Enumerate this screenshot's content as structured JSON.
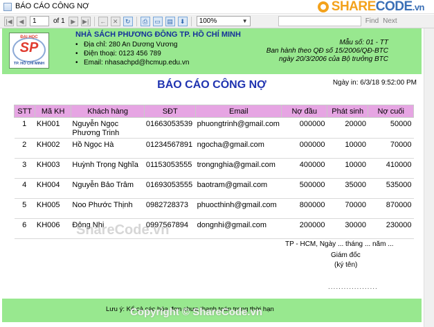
{
  "window": {
    "title": "BÁO CÁO CÔNG NỢ"
  },
  "brand": {
    "logo_part1": "SHARE",
    "logo_part2": "CODE",
    "logo_suffix": ".vn"
  },
  "toolbar": {
    "page_current": "1",
    "page_of": "of 1",
    "zoom": "100%",
    "find_label": "Find",
    "next_label": "Next"
  },
  "school_logo": {
    "top_text": "ĐẠI HỌC",
    "mark": "SP",
    "bottom_text": "TP. HỒ CHÍ MINH"
  },
  "store": {
    "name": "NHÀ SÁCH PHƯƠNG ĐÔNG TP. HỒ CHÍ MINH",
    "address": "Địa chỉ: 280 An Dương Vương",
    "phone": "Điện thoại: 0123 456 789",
    "email": "Email: nhasachpd@hcmup.edu.vn"
  },
  "form_info": {
    "line1": "Mẫu số: 01 - TT",
    "line2": "Ban hành theo QĐ số 15/2006/QĐ-BTC",
    "line3": "ngày 20/3/2006 của Bộ trưởng BTC"
  },
  "report": {
    "title": "BÁO CÁO CÔNG NỢ",
    "print_date": "Ngày in: 6/3/18 9:52:00 PM"
  },
  "table": {
    "headers": [
      "STT",
      "Mã KH",
      "Khách hàng",
      "SĐT",
      "Email",
      "Nợ đầu",
      "Phát sinh",
      "Nợ cuối"
    ],
    "rows": [
      [
        "1",
        "KH001",
        "Nguyễn Ngọc Phương Trinh",
        "01663053539",
        "phuongtrinh@gmail.com",
        "000000",
        "20000",
        "50000"
      ],
      [
        "2",
        "KH002",
        "Hồ Ngọc Hà",
        "01234567891",
        "ngocha@gmail.com",
        "000000",
        "10000",
        "70000"
      ],
      [
        "3",
        "KH003",
        "Huỳnh Trọng Nghĩa",
        "01153053555",
        "trongnghia@gmail.com",
        "400000",
        "10000",
        "410000"
      ],
      [
        "4",
        "KH004",
        "Nguyễn Bảo Trâm",
        "01693053555",
        "baotram@gmail.com",
        "500000",
        "35000",
        "535000"
      ],
      [
        "5",
        "KH005",
        "Noo Phước Thịnh",
        "0982728373",
        "phuocthinh@gmail.com",
        "800000",
        "70000",
        "870000"
      ],
      [
        "6",
        "KH006",
        "Đông Nhi",
        "0997567894",
        "dongnhi@gmail.com",
        "200000",
        "30000",
        "230000"
      ]
    ]
  },
  "signature": {
    "place_date": "TP - HCM, Ngày ...  tháng  ... năm ...",
    "role": "Giám đốc",
    "note": "(ký tên)",
    "dots": "..................."
  },
  "footer": {
    "note": "Lưu ý: Kể cả các hóa đơn chưa thanh toán trong thời hạn"
  },
  "watermarks": {
    "center": "ShareCode.vn",
    "bottom": "Copyright © ShareCode.vn"
  },
  "colors": {
    "band": "#98e88f",
    "header": "#e6a5e3",
    "title": "#1f33b0"
  }
}
